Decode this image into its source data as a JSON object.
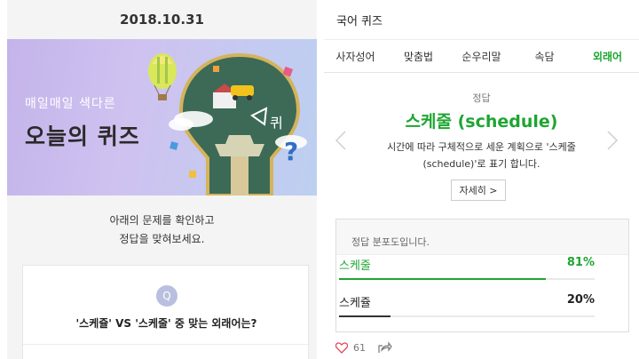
{
  "left": {
    "date": "2018.10.31",
    "banner": {
      "subtitle": "매일매일 색다른",
      "title": "오늘의 퀴즈",
      "decor_text": "퀴"
    },
    "intro_lines": [
      "아래의 문제를 확인하고",
      "정답을 맞혀보세요."
    ],
    "question": {
      "badge": "Q",
      "text": "'스케쥴' VS '스케줄' 중 맞는 외래어는?"
    }
  },
  "right": {
    "title": "국어 퀴즈",
    "tabs": [
      "사자성어",
      "맞춤법",
      "순우리말",
      "속담",
      "외래어"
    ],
    "active_tab": "외래어",
    "answer": {
      "label": "정답",
      "word": "스케줄 (schedule)",
      "description_lines": [
        "시간에 따라 구체적으로 세운 계획으로 '스케줄",
        "(schedule)'로 표기 합니다."
      ],
      "more_button": "자세히 >"
    },
    "distribution": {
      "title": "정답 분포도입니다.",
      "options": [
        {
          "name": "스케줄",
          "percent_label": "81%",
          "percent": 81,
          "correct": true
        },
        {
          "name": "스케쥴",
          "percent_label": "20%",
          "percent": 20,
          "correct": false
        }
      ]
    },
    "footer": {
      "likes": "61"
    }
  },
  "colors": {
    "accent": "#1ea532",
    "banner_bg": "#c4b4ea",
    "badge": "#b9c0df"
  },
  "icons": [
    "chevron-left-icon",
    "chevron-right-icon",
    "heart-icon",
    "share-icon",
    "balloon-icon",
    "lightbulb-icon"
  ]
}
